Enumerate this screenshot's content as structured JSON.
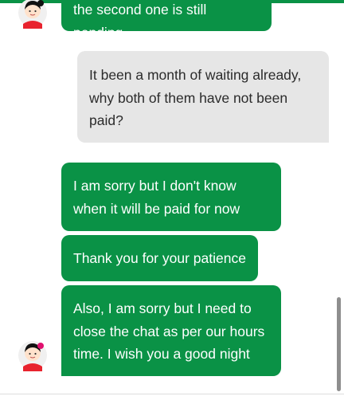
{
  "colors": {
    "agent_bubble": "#0a9246",
    "user_bubble": "#e6e6e6",
    "accent": "#0a9246"
  },
  "messages": [
    {
      "from": "agent",
      "text": "the second one is still pending"
    },
    {
      "from": "user",
      "text": "It been a month of waiting already, why both of them have not been paid?"
    },
    {
      "from": "agent",
      "text": "I am sorry but I don't know when it will be paid for now"
    },
    {
      "from": "agent",
      "text": "Thank you for your patience"
    },
    {
      "from": "agent",
      "text": "Also, I am sorry but I need to close the chat as per our hours time. I wish you a good night"
    }
  ],
  "icons": {
    "agent_avatar": "agent-avatar-icon"
  }
}
